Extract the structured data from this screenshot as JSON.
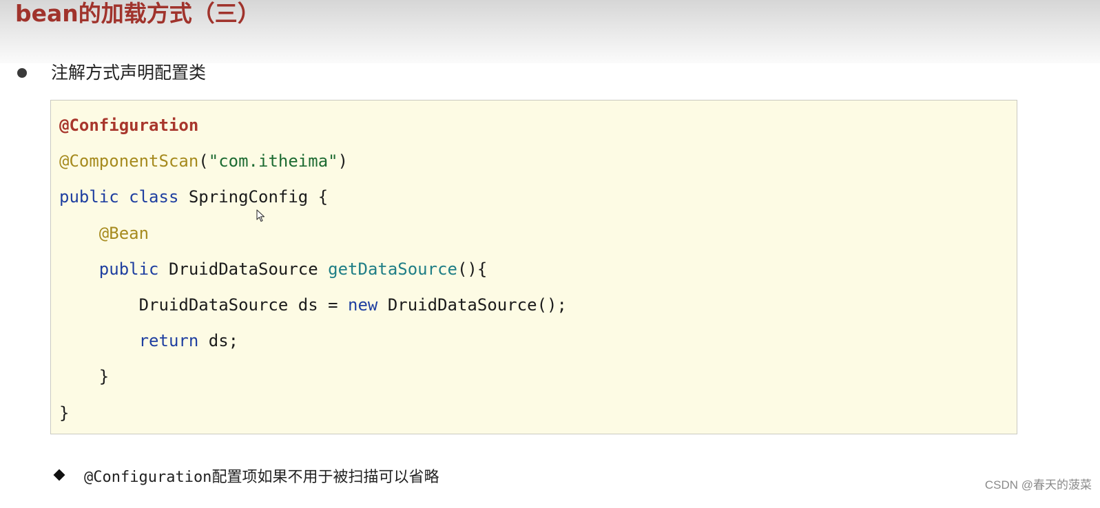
{
  "slide": {
    "title": "bean的加载方式（三）",
    "bullet": "注解方式声明配置类",
    "note_code": "@Configuration",
    "note_text": "配置项如果不用于被扫描可以省略",
    "watermark": "CSDN @春天的菠菜"
  },
  "code": {
    "lines": [
      [
        {
          "t": "@Configuration",
          "c": "ann-bold"
        }
      ],
      [
        {
          "t": "@ComponentScan",
          "c": "ann"
        },
        {
          "t": "(",
          "c": ""
        },
        {
          "t": "\"com.itheima\"",
          "c": "str"
        },
        {
          "t": ")",
          "c": ""
        }
      ],
      [
        {
          "t": "public",
          "c": "kw"
        },
        {
          "t": " ",
          "c": ""
        },
        {
          "t": "class",
          "c": "kw"
        },
        {
          "t": " SpringConfig {",
          "c": ""
        }
      ],
      [
        {
          "t": "    ",
          "c": ""
        },
        {
          "t": "@Bean",
          "c": "ann"
        }
      ],
      [
        {
          "t": "    ",
          "c": ""
        },
        {
          "t": "public",
          "c": "kw"
        },
        {
          "t": " DruidDataSource ",
          "c": ""
        },
        {
          "t": "getDataSource",
          "c": "meth"
        },
        {
          "t": "(){",
          "c": ""
        }
      ],
      [
        {
          "t": "        DruidDataSource ds = ",
          "c": ""
        },
        {
          "t": "new",
          "c": "kw"
        },
        {
          "t": " DruidDataSource();",
          "c": ""
        }
      ],
      [
        {
          "t": "        ",
          "c": ""
        },
        {
          "t": "return",
          "c": "kw"
        },
        {
          "t": " ds;",
          "c": ""
        }
      ],
      [
        {
          "t": "    }",
          "c": ""
        }
      ],
      [
        {
          "t": "}",
          "c": ""
        }
      ]
    ]
  },
  "colors": {
    "title": "#a0332c",
    "annotation_bold": "#a8362c",
    "annotation": "#a68a1e",
    "keyword": "#1f3fa0",
    "string": "#1d6b32",
    "method": "#1f7e86",
    "code_bg": "#fdfbe4"
  },
  "icons": {
    "bullet": "filled-circle",
    "note_marker": "filled-diamond",
    "cursor": "mouse-pointer-icon"
  }
}
